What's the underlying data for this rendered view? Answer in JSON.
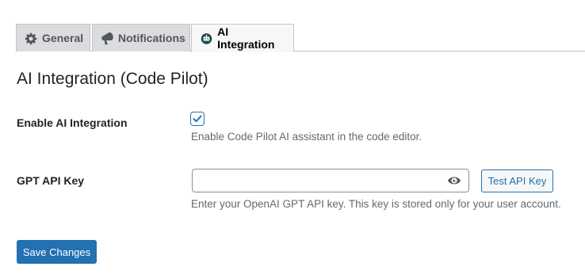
{
  "tabs": [
    {
      "label": "General",
      "icon": "gear-icon",
      "active": false
    },
    {
      "label": "Notifications",
      "icon": "megaphone-icon",
      "active": false
    },
    {
      "label": "AI Integration",
      "icon": "robot-icon",
      "active": true
    }
  ],
  "page": {
    "title": "AI Integration (Code Pilot)"
  },
  "settings": {
    "enable_ai": {
      "label": "Enable AI Integration",
      "checked": true,
      "description": "Enable Code Pilot AI assistant in the code editor."
    },
    "api_key": {
      "label": "GPT API Key",
      "value": "",
      "placeholder": "",
      "description": "Enter your OpenAI GPT API key. This key is stored only for your user account.",
      "test_button_label": "Test API Key"
    }
  },
  "actions": {
    "save_label": "Save Changes"
  },
  "colors": {
    "accent": "#2271b1",
    "tab_inactive_bg": "#dcdcde",
    "tab_active_bg": "#f6f7f7",
    "description_text": "#646970"
  }
}
